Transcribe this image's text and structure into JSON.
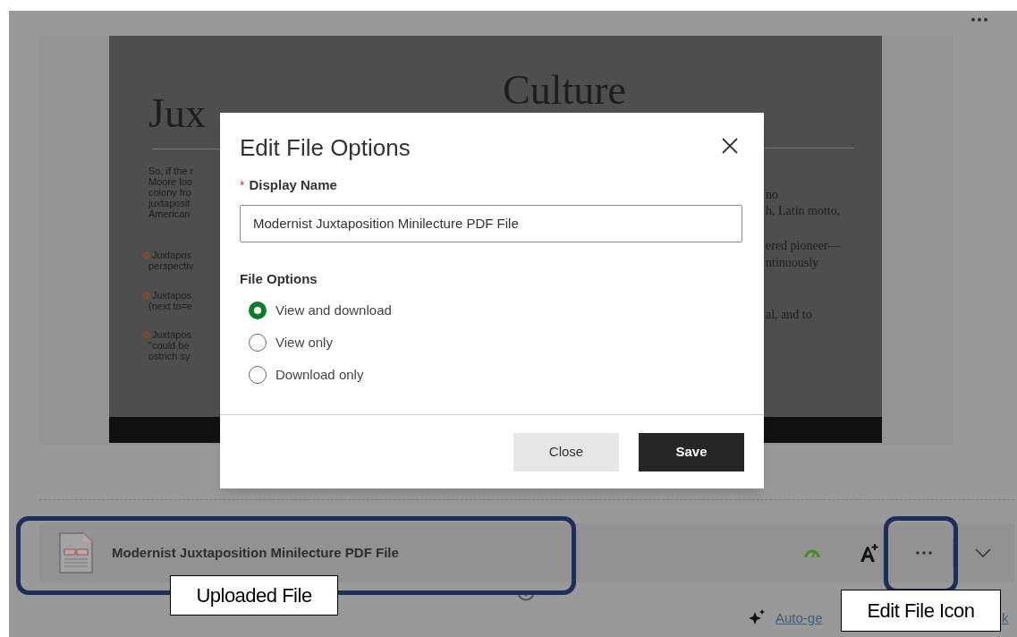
{
  "slide": {
    "title_left": "Jux",
    "title_right": "Culture",
    "left_lines": [
      {
        "text": "So, if the r",
        "kind": "text"
      },
      {
        "text": "Moore loo",
        "kind": "text"
      },
      {
        "text": "colony fro",
        "kind": "text"
      },
      {
        "text": "juxtaposit",
        "kind": "text"
      },
      {
        "text": "American",
        "kind": "text"
      },
      {
        "text": "Juxtapos",
        "kind": "bullet"
      },
      {
        "text": "perspectiv",
        "kind": "text"
      },
      {
        "text": "Juxtapos",
        "kind": "bullet"
      },
      {
        "text": "(next to=e",
        "kind": "text"
      },
      {
        "text": "Juxtapos",
        "kind": "bullet"
      },
      {
        "text": "\"could be",
        "kind": "text"
      },
      {
        "text": "ostrich sy",
        "kind": "text"
      }
    ],
    "right_lines": [
      "no",
      "h, Latin motto,",
      "ered pioneer—",
      "ntinuously",
      "al, and to"
    ]
  },
  "dialog": {
    "title": "Edit File Options",
    "display_name": {
      "label": "Display Name",
      "required_mark": "*",
      "value": "Modernist Juxtaposition Minilecture PDF File"
    },
    "file_options": {
      "label": "File Options",
      "options": [
        {
          "label": "View and download",
          "selected": true
        },
        {
          "label": "View only",
          "selected": false
        },
        {
          "label": "Download only",
          "selected": false
        }
      ]
    },
    "buttons": [
      {
        "label": "Close",
        "kind": "secondary"
      },
      {
        "label": "Save",
        "kind": "primary"
      }
    ]
  },
  "file_row": {
    "name": "Modernist Juxtaposition Minilecture PDF File"
  },
  "link_fragments": [
    "Auto-ge",
    "k"
  ],
  "annotations": [
    {
      "label": "Uploaded File",
      "kind": "file"
    },
    {
      "label": "Edit File Icon",
      "kind": "menu"
    }
  ]
}
